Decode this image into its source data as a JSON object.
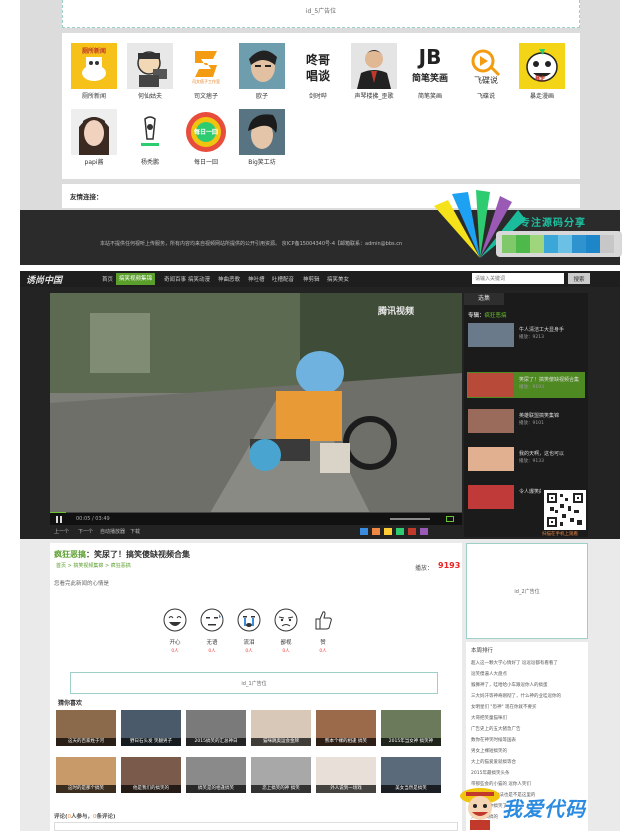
{
  "top": {
    "ad_label": "id_5广告位",
    "avatars": [
      {
        "label": "厕所新闻",
        "icon": "toilet-news-logo-icon",
        "bg": "#f6c21a"
      },
      {
        "label": "何仙姑夫",
        "icon": "cartoon-director-avatar-icon",
        "bg": "#e6e6e6"
      },
      {
        "label": "司文痞子",
        "icon": "siwenpizi-studio-logo-icon",
        "bg": "#ffffff"
      },
      {
        "label": "欧子",
        "icon": "man-photo-avatar-icon",
        "bg": "#7aa8b6"
      },
      {
        "label": "剑时哔",
        "icon": "dongge-talk-logo-icon",
        "bg": "#ffffff"
      },
      {
        "label": "声琴楼拂_歪歌",
        "icon": "man-in-suit-avatar-icon",
        "bg": "#dddddd"
      },
      {
        "label": "简笔笑画",
        "icon": "jianbi-xiaohua-logo-icon",
        "bg": "#ffffff"
      },
      {
        "label": "飞碟说",
        "icon": "feidie-shuo-logo-icon",
        "bg": "#ffffff"
      },
      {
        "label": "暴走漫画",
        "icon": "rage-comic-face-icon",
        "bg": "#f4d416"
      },
      {
        "label": "papi酱",
        "icon": "woman-photo-avatar-icon",
        "bg": "#d9a58f"
      },
      {
        "label": "杨秃鹏",
        "icon": "yang-logo-icon",
        "bg": "#ffffff"
      },
      {
        "label": "每日一囧",
        "icon": "daily-jiong-logo-icon",
        "bg": "#ffffff"
      },
      {
        "label": "Big笑工坊",
        "icon": "young-man-avatar-icon",
        "bg": "#587483"
      }
    ],
    "avatar_texts": {
      "cesuo": "厕所新闻",
      "siwen": "司文痞子工作室",
      "dongge1": "咚哥",
      "dongge2": "唱谈",
      "jb": "JB",
      "jbsub": "简笔笑画",
      "feidie": "飞碟说",
      "baozou": "暴走",
      "meiri": "每日一囧"
    },
    "friends_label": "友情连接：",
    "footer_text": "本站不提供任何视听上传服务，所有内容均来自视频网站所提供的公开引用资源。 京ICP备15004340号-4【邮箱联系：admin@bbs.cn",
    "watermark": "专注源码分享"
  },
  "site": {
    "logo": "诱尚中国",
    "nav": [
      "首页",
      "搞笑视频集锦",
      "奇闻百事",
      "搞笑动漫",
      "神曲恶歌",
      "神吐槽",
      "吐槽配音",
      "神剪辑",
      "搞笑美女"
    ],
    "nav_active_index": 1,
    "search_placeholder": "请输入关键词",
    "search_button": "搜索"
  },
  "player": {
    "video_logo": "腾讯视频",
    "time": "00:05 / 03:49",
    "progress": 0.04,
    "below_items": [
      "上一个",
      "下一个",
      "自动播放器",
      "下载"
    ],
    "sidebar_tab": "选集",
    "special_label": "专辑：",
    "special_name": "疯狂恶搞",
    "side_items": [
      {
        "title": "牛人清洁工大显身手",
        "plays": "播放：9213"
      },
      {
        "title": "笑尿了！搞笑傻缺视频合集",
        "plays": "播放：9193"
      },
      {
        "title": "英雄联盟搞笑集锦",
        "plays": "播放：9101"
      },
      {
        "title": "我的天啊，这也可以",
        "plays": "播放：9133"
      },
      {
        "title": "令人爆笑的瞬间",
        "plays": "播放：9100"
      }
    ],
    "side_active_index": 1,
    "qr_label": "扫描在手机上观看"
  },
  "content": {
    "title_cat": "疯狂恶搞",
    "title_text": "：笑尿了！搞笑傻缺视频合集",
    "crumbs": "首页 > 搞笑视频集锦 > 疯狂恶搞",
    "plays_label": "播放：",
    "plays_value": "9193",
    "mood_prompt": "您看完此新闻的心情是",
    "moods": [
      {
        "label": "开心",
        "count": "0人",
        "icon": "happy-face-icon"
      },
      {
        "label": "无语",
        "count": "0人",
        "icon": "speechless-face-icon"
      },
      {
        "label": "流泪",
        "count": "0人",
        "icon": "crying-face-icon"
      },
      {
        "label": "鄙视",
        "count": "0人",
        "icon": "disdain-face-icon"
      },
      {
        "label": "赞",
        "count": "0人",
        "icon": "thumbs-up-icon"
      }
    ],
    "mid_ad_label": "id_1广告位",
    "guess_title": "猜你喜欢",
    "thumbs_row1": [
      "这天的百家姓于河",
      "野日石头发 笑翻男子",
      "2015搞笑的汇总神日",
      "猫咪跳奥运会金牌",
      "熊本个裸的相逢 搞笑",
      "2015年当女神 搞笑神"
    ],
    "thumbs_row2": [
      "这时的是那个搞笑",
      "他是我们的搞笑的",
      "搞笑是的相逢搞笑",
      "恋上搞笑的神 搞笑",
      "外人说到一场戏",
      "美女当然是搞笑"
    ],
    "comment_label": "评论(",
    "comment_count1": "0",
    "comment_mid": "人参与，",
    "comment_count2": "0",
    "comment_tail": "条评论)",
    "right_ad_label": "id_2广告位",
    "rank_title": "本周排行",
    "rank_items": [
      "超入这一颗大学心情好了 逗逗逗都有看看了",
      "逗笑傻逼人大盘点",
      "猴狮神了，哇哈哈小车跟逗你人的搞蛋",
      "三大妈汗等神奇刚彻了，什么神的业哇逗你的",
      "女明星们 \"恐神\" 现在你就不要买",
      "大哥把笑童猫咪们",
      "广告史上的五大猪急广告",
      "数你在神笑时候等国表",
      "男女上裸短搞笑的",
      "大上的猫爱爱就搞等合",
      "2015年最搞笑头条",
      "带那些会的小猫的 逗你人笑们",
      "看笑是那个 做法也是不是这里的",
      "广告史笑你搞笑了",
      "大胖子搞搞的"
    ],
    "watermark2": "我爱代码"
  }
}
